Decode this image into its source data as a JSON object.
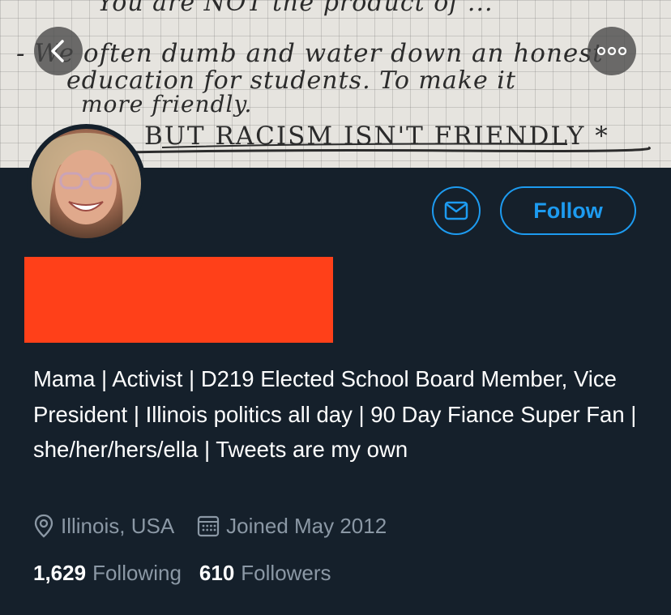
{
  "banner": {
    "lines": [
      "You are NOT the product of ...",
      "- We often dumb and water down an honest",
      "education for students. To make it",
      "more friendly.",
      "BUT RACISM ISN'T FRIENDLY *"
    ]
  },
  "icons": {
    "back": "chevron-left-icon",
    "more": "more-dots-icon",
    "message": "envelope-icon",
    "location": "location-pin-icon",
    "calendar": "calendar-icon"
  },
  "actions": {
    "follow_label": "Follow"
  },
  "profile": {
    "bio": "Mama | Activist | D219 Elected School Board Member, Vice President | Illinois politics all day | 90 Day Fiance Super Fan | she/her/hers/ella | Tweets are my own",
    "location": "Illinois, USA",
    "joined": "Joined May 2012",
    "following_count": "1,629",
    "following_label": "Following",
    "followers_count": "610",
    "followers_label": "Followers"
  },
  "colors": {
    "background": "#15202b",
    "accent": "#1d9bf0",
    "secondary_text": "#8b98a5",
    "redaction": "#ff4019"
  }
}
